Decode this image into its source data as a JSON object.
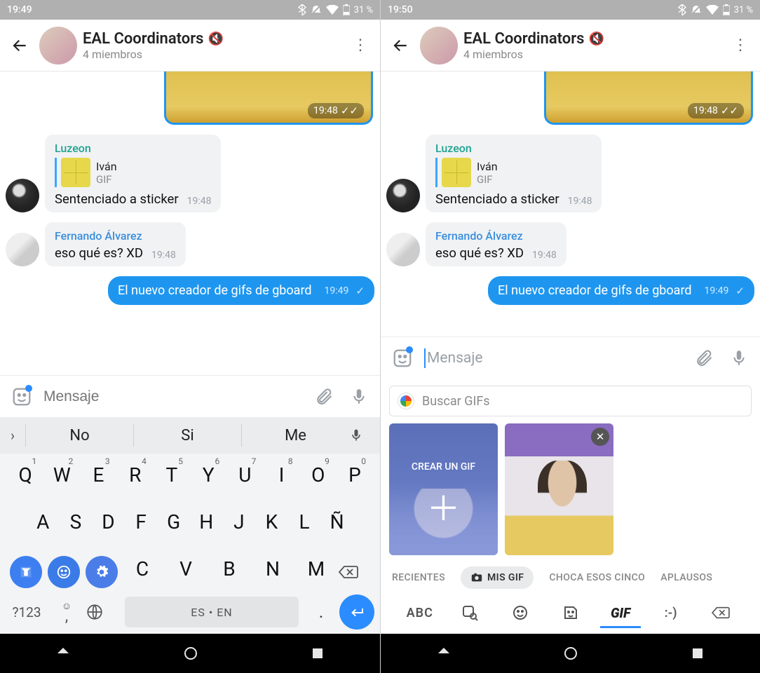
{
  "left": {
    "statusbar": {
      "time": "19:49",
      "battery": "31 %"
    },
    "header": {
      "title": "EAL Coordinators",
      "subtitle": "4 miembros"
    },
    "img_time": "19:48",
    "msg1": {
      "sender": "Luzeon",
      "reply_name": "Iván",
      "reply_type": "GIF",
      "text": "Sentenciado a sticker",
      "time": "19:48"
    },
    "msg2": {
      "sender": "Fernando Álvarez",
      "text": "eso qué es? XD",
      "time": "19:48"
    },
    "msg3": {
      "text": "El nuevo creador de gifs de gboard",
      "time": "19:49"
    },
    "input": {
      "placeholder": "Mensaje"
    },
    "suggestions": [
      "No",
      "Si",
      "Me"
    ],
    "row1": [
      {
        "k": "Q",
        "s": "1"
      },
      {
        "k": "W",
        "s": "2"
      },
      {
        "k": "E",
        "s": "3"
      },
      {
        "k": "R",
        "s": "4"
      },
      {
        "k": "T",
        "s": "5"
      },
      {
        "k": "Y",
        "s": "6"
      },
      {
        "k": "U",
        "s": "7"
      },
      {
        "k": "I",
        "s": "8"
      },
      {
        "k": "O",
        "s": "9"
      },
      {
        "k": "P",
        "s": "0"
      }
    ],
    "row2": [
      "A",
      "S",
      "D",
      "F",
      "G",
      "H",
      "J",
      "K",
      "L",
      "Ñ"
    ],
    "row3": [
      "C",
      "V",
      "B",
      "N",
      "M"
    ],
    "sym_label": "?123",
    "space_label": "ES • EN"
  },
  "right": {
    "statusbar": {
      "time": "19:50",
      "battery": "31 %"
    },
    "header": {
      "title": "EAL Coordinators",
      "subtitle": "4 miembros"
    },
    "img_time": "19:48",
    "msg1": {
      "sender": "Luzeon",
      "reply_name": "Iván",
      "reply_type": "GIF",
      "text": "Sentenciado a sticker",
      "time": "19:48"
    },
    "msg2": {
      "sender": "Fernando Álvarez",
      "text": "eso qué es? XD",
      "time": "19:48"
    },
    "msg3": {
      "text": "El nuevo creador de gifs de gboard",
      "time": "19:49"
    },
    "input": {
      "placeholder": "Mensaje"
    },
    "gif_search_placeholder": "Buscar GIFs",
    "create_label": "CREAR UN GIF",
    "cats": {
      "recent": "RECIENTES",
      "mygif": "MIS GIF",
      "choca": "CHOCA ESOS CINCO",
      "aplausos": "APLAUSOS"
    },
    "abc": "ABC",
    "gif": "GIF",
    "emoticon": ":-)"
  }
}
